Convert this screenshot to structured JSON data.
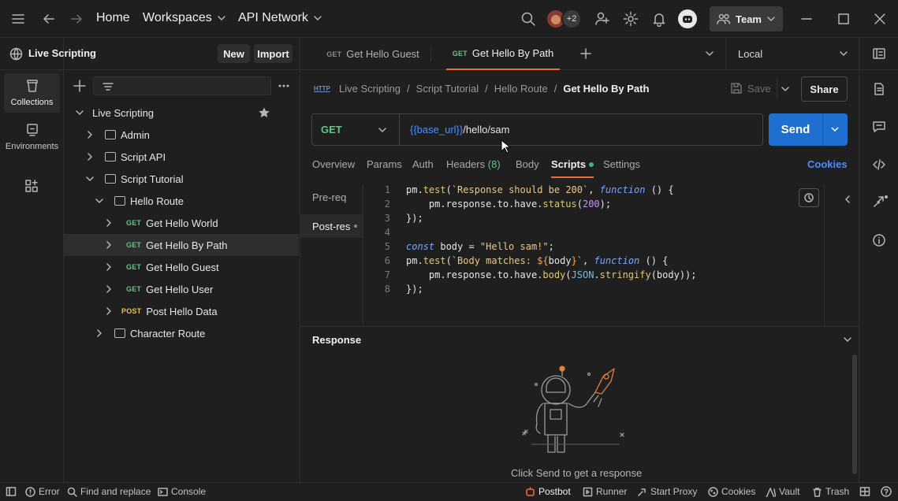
{
  "topbar": {
    "home": "Home",
    "workspaces": "Workspaces",
    "api_network": "API Network",
    "avatar_count": "+2",
    "team": "Team"
  },
  "rail": {
    "collections": "Collections",
    "environments": "Environments"
  },
  "workspace": {
    "title": "Live Scripting",
    "new_label": "New",
    "import_label": "Import"
  },
  "tree": {
    "root": "Live Scripting",
    "items": [
      {
        "label": "Admin",
        "kind": "folder"
      },
      {
        "label": "Script API",
        "kind": "folder"
      },
      {
        "label": "Script Tutorial",
        "kind": "folder"
      },
      {
        "label": "Hello Route",
        "kind": "folder"
      },
      {
        "label": "Get Hello World",
        "kind": "request",
        "method": "GET"
      },
      {
        "label": "Get Hello By Path",
        "kind": "request",
        "method": "GET"
      },
      {
        "label": "Get Hello Guest",
        "kind": "request",
        "method": "GET"
      },
      {
        "label": "Get Hello User",
        "kind": "request",
        "method": "GET"
      },
      {
        "label": "Post Hello Data",
        "kind": "request",
        "method": "POST"
      },
      {
        "label": "Character Route",
        "kind": "folder"
      }
    ]
  },
  "tabs": [
    {
      "method": "GET",
      "label": "Get Hello Guest"
    },
    {
      "method": "GET",
      "label": "Get Hello By Path"
    }
  ],
  "environment": "Local",
  "breadcrumb": {
    "http": "HTTP",
    "c1": "Live Scripting",
    "c2": "Script Tutorial",
    "c3": "Hello Route",
    "current": "Get Hello By Path",
    "sep": "/"
  },
  "actions": {
    "save": "Save",
    "share": "Share"
  },
  "request": {
    "method": "GET",
    "url_var": "{{base_url}}",
    "url_path": "/hello/sam",
    "send": "Send"
  },
  "req_tabs": {
    "overview": "Overview",
    "params": "Params",
    "auth": "Auth",
    "headers": "Headers",
    "headers_count": "(8)",
    "body": "Body",
    "scripts": "Scripts",
    "settings": "Settings",
    "cookies": "Cookies"
  },
  "script_tabs": {
    "pre": "Pre-req",
    "post": "Post-res"
  },
  "code": {
    "lines": [
      "1",
      "2",
      "3",
      "4",
      "5",
      "6",
      "7",
      "8"
    ],
    "l1": {
      "a": "pm.",
      "b": "test",
      "c": "(",
      "d": "`Response should be 200`",
      "e": ", ",
      "f": "function",
      "g": " () {"
    },
    "l2": {
      "a": "    pm.response.to.have.",
      "b": "status",
      "c": "(",
      "d": "200",
      "e": ");"
    },
    "l3": "});",
    "l5": {
      "a": "const",
      "b": " body = ",
      "c": "\"Hello sam!\"",
      "d": ";"
    },
    "l6": {
      "a": "pm.",
      "b": "test",
      "c": "(",
      "d": "`Body matches: ",
      "e": "${",
      "f": "body",
      "g": "}",
      "h": "`",
      "i": ", ",
      "j": "function",
      "k": " () {"
    },
    "l7": {
      "a": "    pm.response.to.have.",
      "b": "body",
      "c": "(",
      "d": "JSON",
      "e": ".",
      "f": "stringify",
      "g": "(body));"
    },
    "l8": "});"
  },
  "response": {
    "title": "Response",
    "empty": "Click Send to get a response"
  },
  "statusbar": {
    "error": "Error",
    "find": "Find and replace",
    "console": "Console",
    "postbot": "Postbot",
    "runner": "Runner",
    "proxy": "Start Proxy",
    "cookies": "Cookies",
    "vault": "Vault",
    "trash": "Trash"
  },
  "colors": {
    "accent": "#f26b3a",
    "send": "#1f6fd1",
    "get": "#6bbf8a",
    "post": "#e2c25a",
    "link": "#4c8dff"
  }
}
